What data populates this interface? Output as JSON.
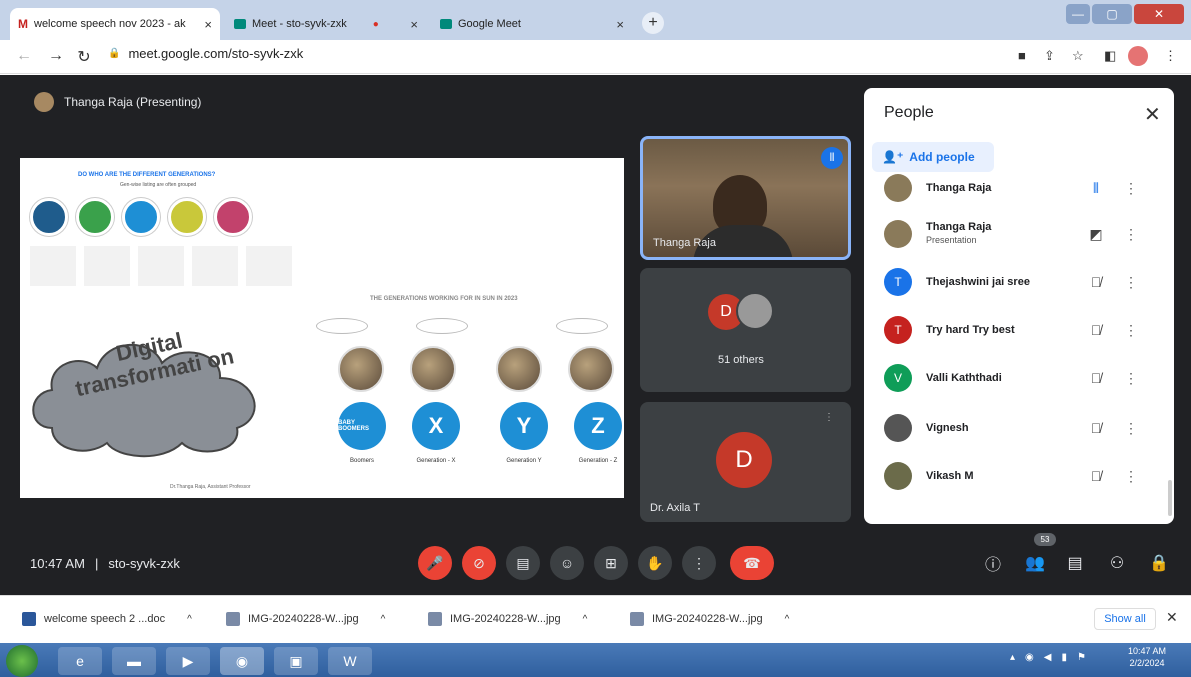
{
  "browser": {
    "tabs": [
      {
        "title": "welcome speech nov 2023 - ak",
        "icon": "gmail-icon",
        "close": "×"
      },
      {
        "title": "Meet - sto-syvk-zxk",
        "icon": "meet-icon",
        "close": "×"
      },
      {
        "title": "Google Meet",
        "icon": "meet-icon",
        "close": "×"
      }
    ],
    "new_tab": "+",
    "url": "meet.google.com/sto-syvk-zxk"
  },
  "meet": {
    "presenter_label": "Thanga Raja (Presenting)",
    "slide": {
      "heading": "DO WHO ARE THE DIFFERENT GENERATIONS?",
      "subheading": "Gen-wise listing are often grouped",
      "section_title": "THE GENERATIONS WORKING FOR IN SUN IN 2023",
      "cloud_text": "Digital transformati on",
      "generations": [
        {
          "letter": "",
          "label": "BABY BOOMERS",
          "caption": "Boomers"
        },
        {
          "letter": "X",
          "label": "",
          "caption": "Generation - X"
        },
        {
          "letter": "Y",
          "label": "",
          "caption": "Generation Y"
        },
        {
          "letter": "Z",
          "label": "",
          "caption": "Generation - Z"
        }
      ],
      "footer": "Dr.Thanga Raja, Assistant Professor"
    },
    "tiles": {
      "camera_name": "Thanga Raja",
      "others_letter": "D",
      "others_label": "51 others",
      "axila_letter": "D",
      "axila_name": "Dr. Axila T"
    },
    "clock": "10:47 AM",
    "meeting_code": "sto-syvk-zxk",
    "participant_badge": "53"
  },
  "people_panel": {
    "title": "People",
    "add_label": "Add people",
    "people": [
      {
        "name": "Thanga Raja",
        "sub": "",
        "initial": "",
        "color": "#8a7a5a",
        "mic": "speaking"
      },
      {
        "name": "Thanga Raja",
        "sub": "Presentation",
        "initial": "",
        "color": "#8a7a5a",
        "mic": "presenting"
      },
      {
        "name": "Thejashwini jai sree",
        "sub": "",
        "initial": "T",
        "color": "#1a73e8",
        "mic": "muted"
      },
      {
        "name": "Try hard Try best",
        "sub": "",
        "initial": "T",
        "color": "#c5221f",
        "mic": "muted"
      },
      {
        "name": "Valli Kaththadi",
        "sub": "",
        "initial": "V",
        "color": "#0f9d58",
        "mic": "muted"
      },
      {
        "name": "Vignesh",
        "sub": "",
        "initial": "",
        "color": "#555",
        "mic": "muted"
      },
      {
        "name": "Vikash M",
        "sub": "",
        "initial": "",
        "color": "#6b6b4a",
        "mic": "muted"
      }
    ]
  },
  "downloads": [
    {
      "name": "welcome speech 2 ...doc"
    },
    {
      "name": "IMG-20240228-W...jpg"
    },
    {
      "name": "IMG-20240228-W...jpg"
    },
    {
      "name": "IMG-20240228-W...jpg"
    }
  ],
  "show_all": "Show all",
  "taskbar_clock": {
    "time": "10:47 AM",
    "date": "2/2/2024"
  }
}
